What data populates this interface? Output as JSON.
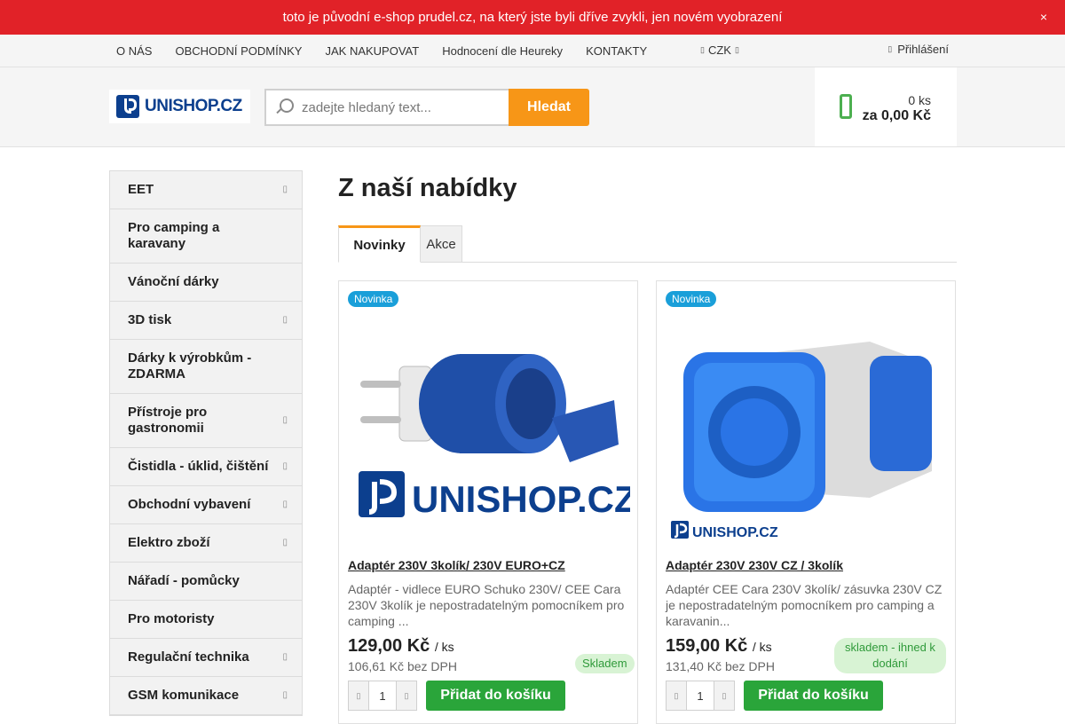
{
  "announcement": {
    "text": "toto je původní e-shop prudel.cz, na který jste byli dříve zvykli, jen novém vyobrazení",
    "close_icon": "×"
  },
  "topnav": {
    "links": [
      "O NÁS",
      "OBCHODNÍ PODMÍNKY",
      "JAK NAKUPOVAT",
      "Hodnocení dle Heureky",
      "KONTAKTY"
    ],
    "currency": "CZK",
    "login": "Přihlášení"
  },
  "header": {
    "logo_text": "UNISHOP.CZ",
    "search_placeholder": "zadejte hledaný text...",
    "search_button": "Hledat",
    "cart_count": "0 ks",
    "cart_total": "za 0,00 Kč"
  },
  "sidebar": {
    "categories": [
      {
        "label": "EET",
        "has_sub": true
      },
      {
        "label": "Pro camping a karavany",
        "has_sub": false
      },
      {
        "label": "Vánoční dárky",
        "has_sub": false
      },
      {
        "label": "3D tisk",
        "has_sub": true
      },
      {
        "label": "Dárky k výrobkům - ZDARMA",
        "has_sub": false
      },
      {
        "label": "Přístroje pro gastronomii",
        "has_sub": true
      },
      {
        "label": "Čistidla - úklid, čištění",
        "has_sub": true
      },
      {
        "label": "Obchodní vybavení",
        "has_sub": true
      },
      {
        "label": "Elektro zboží",
        "has_sub": true
      },
      {
        "label": "Nářadí - pomůcky",
        "has_sub": false
      },
      {
        "label": "Pro motoristy",
        "has_sub": false
      },
      {
        "label": "Regulační technika",
        "has_sub": true
      },
      {
        "label": "GSM komunikace",
        "has_sub": true
      }
    ]
  },
  "main": {
    "title": "Z naší nabídky",
    "tabs": [
      {
        "label": "Novinky",
        "active": true
      },
      {
        "label": "Akce",
        "active": false
      }
    ]
  },
  "products": [
    {
      "badge": "Novinka",
      "name": "Adaptér 230V 3kolík/ 230V EURO+CZ",
      "description": "Adaptér - vidlece EURO Schuko 230V/ CEE Cara 230V 3kolík je nepostradatelným pomocníkem pro camping ...",
      "price": "129,00 Kč",
      "unit": "/ ks",
      "price_net": "106,61 Kč bez DPH",
      "stock": "Skladem",
      "qty": "1",
      "add_label": "Přidat do košíku",
      "image_logo": "UNISHOP.CZ"
    },
    {
      "badge": "Novinka",
      "name": "Adaptér 230V 230V CZ / 3kolík",
      "description": "Adaptér CEE Cara 230V 3kolík/ zásuvka 230V CZ je nepostradatelným pomocníkem pro camping a karavanin...",
      "price": "159,00 Kč",
      "unit": "/ ks",
      "price_net": "131,40 Kč bez DPH",
      "stock": "skladem - ihned k dodání",
      "qty": "1",
      "add_label": "Přidat do košíku",
      "image_logo": "UNISHOP.CZ"
    }
  ],
  "colors": {
    "announcement_bg": "#e12228",
    "accent_orange": "#f79617",
    "add_button_green": "#2aa53a",
    "badge_blue": "#1a9fd9"
  }
}
